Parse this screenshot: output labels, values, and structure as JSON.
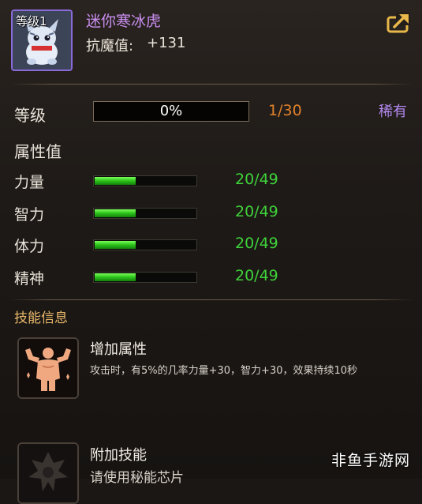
{
  "pet": {
    "level_badge": "等级1",
    "name": "迷你寒冰虎",
    "resist_label": "抗魔值:",
    "resist_value": "+131"
  },
  "level": {
    "label": "等级",
    "progress_text": "0%",
    "progress_fraction": 0.0,
    "count": "1/30",
    "rarity": "稀有"
  },
  "attributes": {
    "title": "属性值",
    "stats": [
      {
        "label": "力量",
        "value": "20/49",
        "fraction": 0.41
      },
      {
        "label": "智力",
        "value": "20/49",
        "fraction": 0.41
      },
      {
        "label": "体力",
        "value": "20/49",
        "fraction": 0.41
      },
      {
        "label": "精神",
        "value": "20/49",
        "fraction": 0.41
      }
    ]
  },
  "skills": {
    "title": "技能信息",
    "items": [
      {
        "name": "增加属性",
        "desc": "攻击时，有5%的几率力量+30，智力+30，效果持续10秒",
        "icon": "muscle-icon"
      },
      {
        "name": "附加技能",
        "desc": "请使用秘能芯片",
        "icon": "locked-skill-icon"
      }
    ]
  },
  "watermark": "非鱼手游网",
  "colors": {
    "name_purple": "#c98ef0",
    "level_orange": "#e0822a",
    "rarity_purple": "#b48af0",
    "stat_green": "#3fd23a",
    "skill_title_gold": "#e8b86a"
  }
}
